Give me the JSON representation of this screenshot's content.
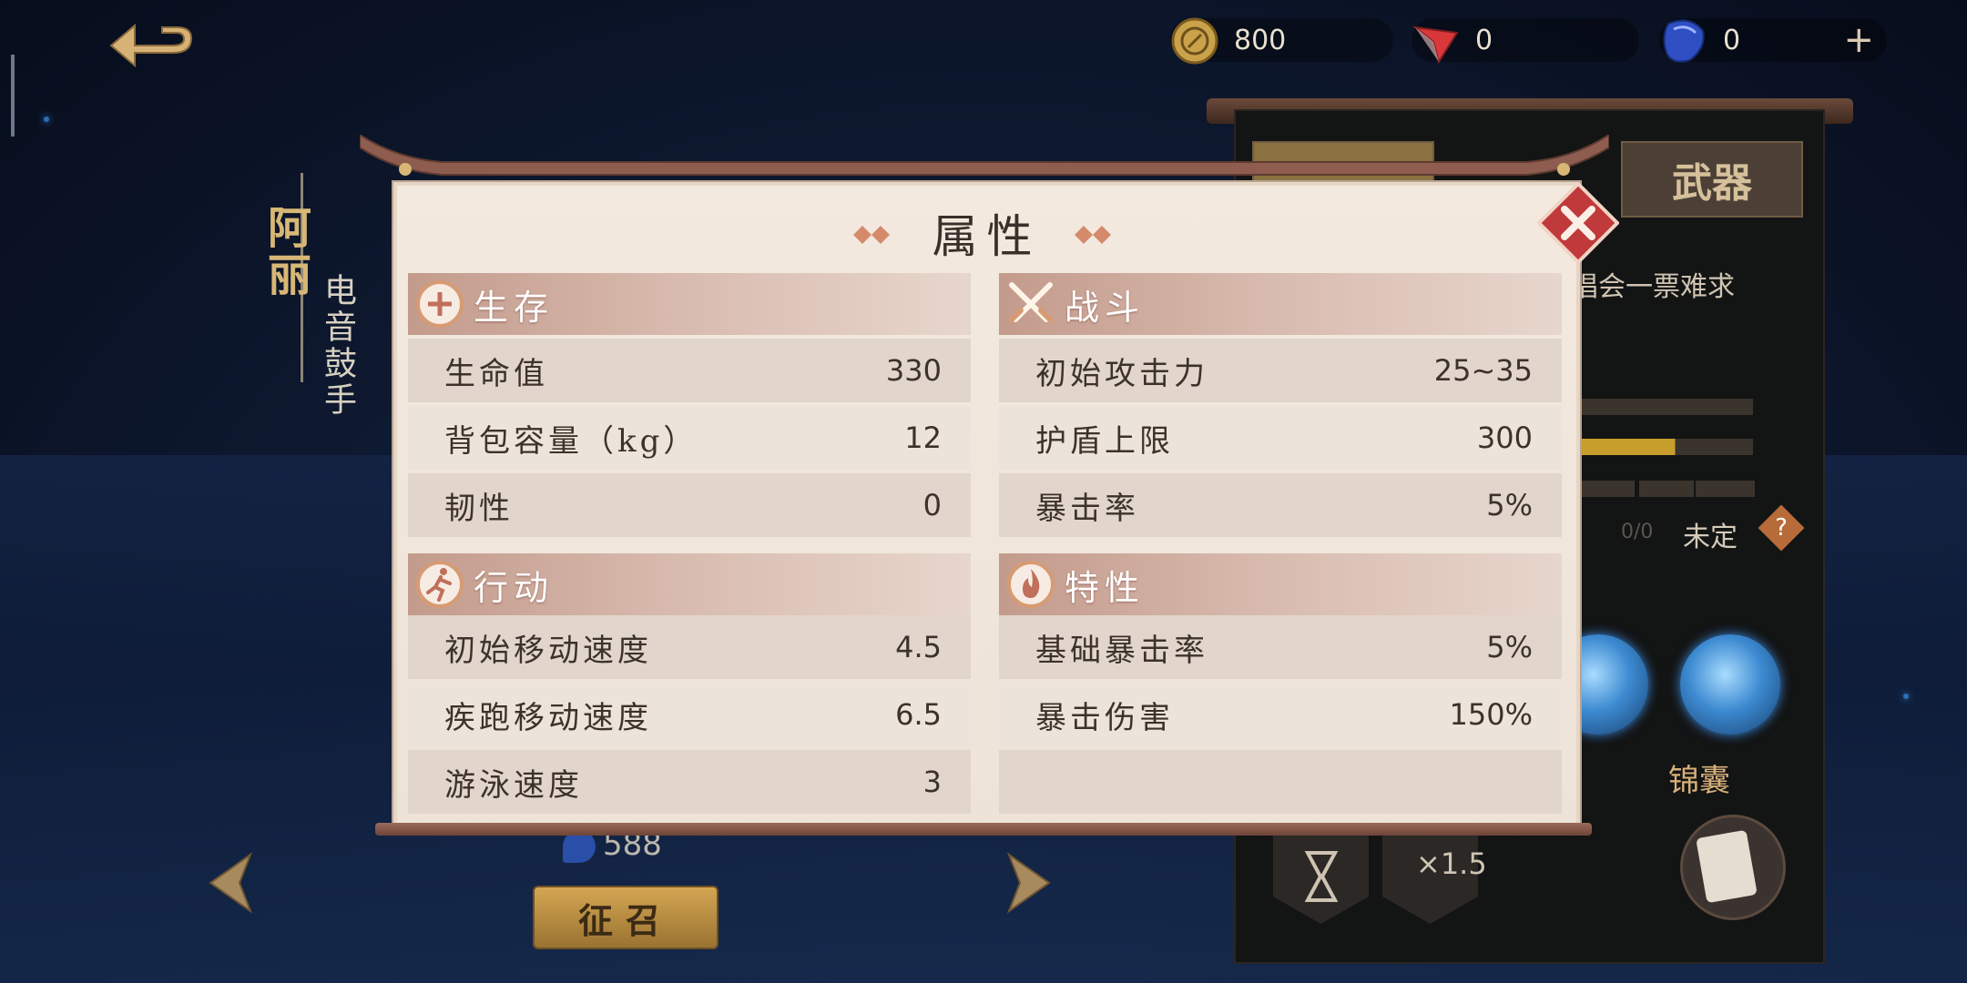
{
  "header": {
    "currencies": [
      {
        "icon": "gold-coin-icon",
        "value": "800"
      },
      {
        "icon": "red-crystal-icon",
        "value": "0"
      },
      {
        "icon": "blue-gem-icon",
        "value": "0"
      }
    ],
    "add_label": "+"
  },
  "character": {
    "name": "阿丽",
    "title": "电音鼓手"
  },
  "background_panel": {
    "tab_weapon": "武器",
    "quote": "唱会一票难求",
    "ratio": "0/0",
    "uncertain": "未定",
    "help": "?",
    "kit_label": "锦囊",
    "speed_label": "×1.5"
  },
  "bottom": {
    "gem_count": "588",
    "recruit_label": "征召"
  },
  "modal": {
    "title": "属性",
    "sections": {
      "survival": {
        "title": "生存",
        "icon": "plus-circle-icon",
        "rows": [
          {
            "label": "生命值",
            "value": "330"
          },
          {
            "label": "背包容量（kg）",
            "value": "12"
          },
          {
            "label": "韧性",
            "value": "0"
          }
        ]
      },
      "combat": {
        "title": "战斗",
        "icon": "crossed-swords-icon",
        "rows": [
          {
            "label": "初始攻击力",
            "value": "25~35"
          },
          {
            "label": "护盾上限",
            "value": "300"
          },
          {
            "label": "暴击率",
            "value": "5%"
          }
        ]
      },
      "movement": {
        "title": "行动",
        "icon": "running-figure-icon",
        "rows": [
          {
            "label": "初始移动速度",
            "value": "4.5"
          },
          {
            "label": "疾跑移动速度",
            "value": "6.5"
          },
          {
            "label": "游泳速度",
            "value": "3"
          }
        ]
      },
      "traits": {
        "title": "特性",
        "icon": "flame-icon",
        "rows": [
          {
            "label": "基础暴击率",
            "value": "5%"
          },
          {
            "label": "暴击伤害",
            "value": "150%"
          },
          {
            "label": "",
            "value": ""
          }
        ]
      }
    }
  },
  "colors": {
    "accent_gold": "#d8b776",
    "section_header": "#c39b8c",
    "close_red": "#c0393b"
  }
}
